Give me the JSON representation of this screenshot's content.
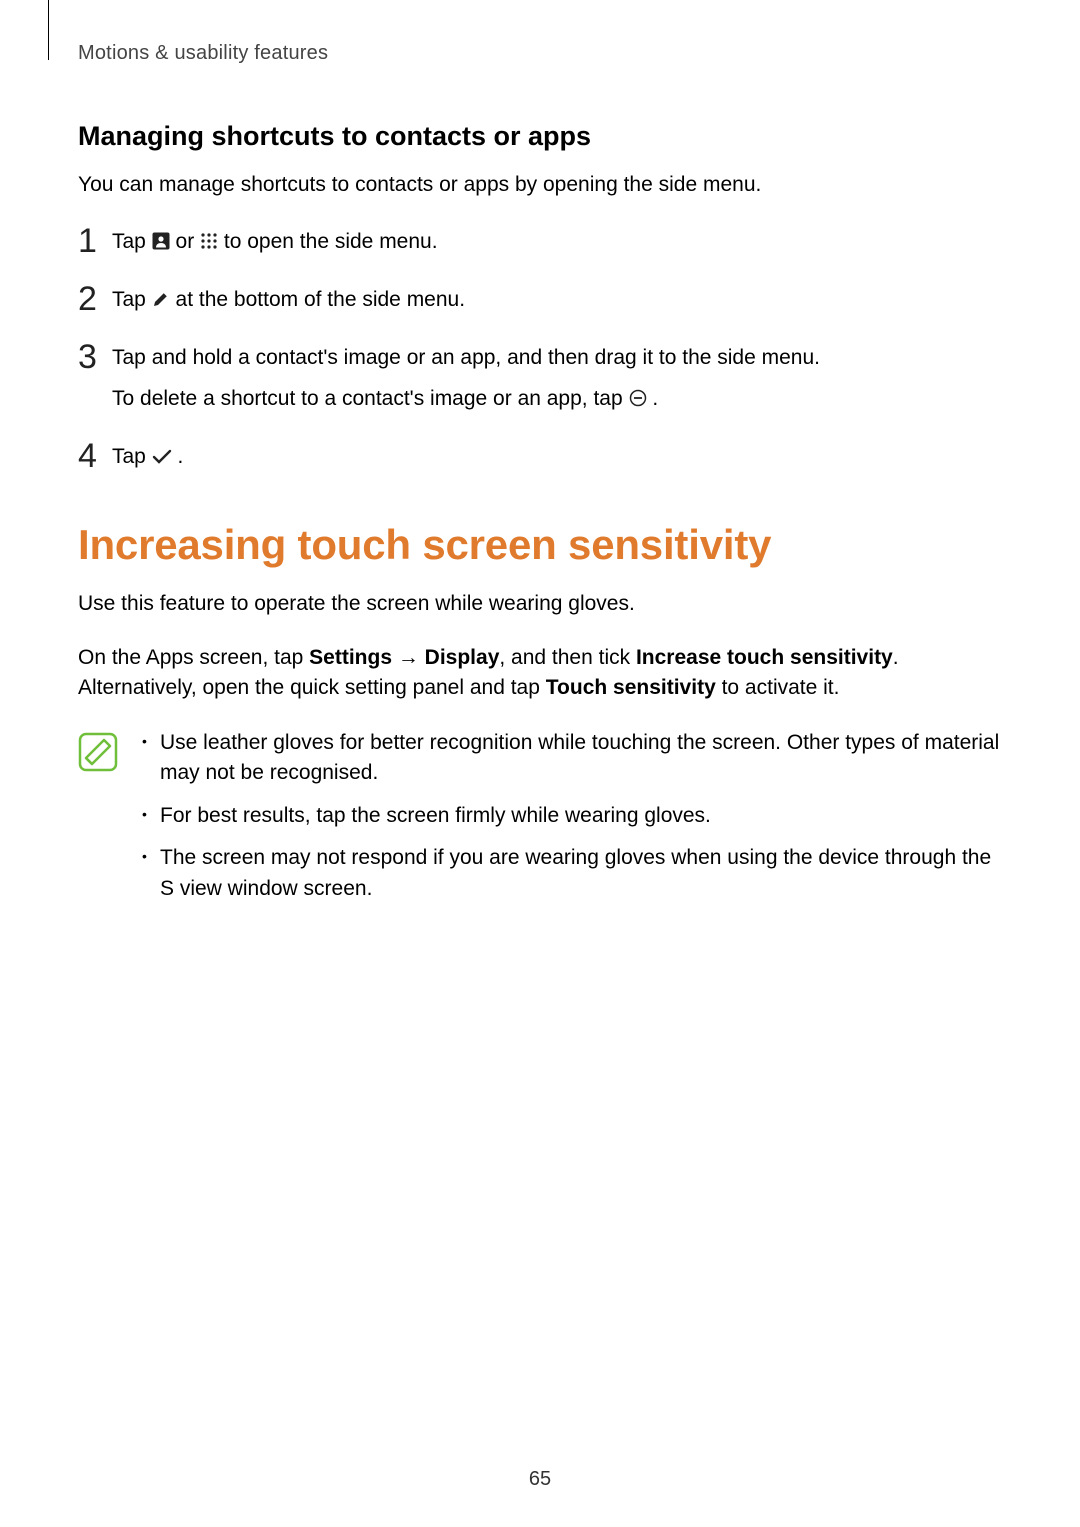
{
  "header": {
    "running_head": "Motions & usability features"
  },
  "subsection": {
    "title": "Managing shortcuts to contacts or apps",
    "intro": "You can manage shortcuts to contacts or apps by opening the side menu."
  },
  "steps": [
    {
      "num": "1",
      "pre": "Tap ",
      "mid_or": " or ",
      "post": " to open the side menu."
    },
    {
      "num": "2",
      "pre": "Tap ",
      "post": " at the bottom of the side menu."
    },
    {
      "num": "3",
      "line1": "Tap and hold a contact's image or an app, and then drag it to the side menu.",
      "line2_pre": "To delete a shortcut to a contact's image or an app, tap ",
      "line2_post": "."
    },
    {
      "num": "4",
      "pre": "Tap ",
      "post": "."
    }
  ],
  "section": {
    "title": "Increasing touch screen sensitivity",
    "p1": "Use this feature to operate the screen while wearing gloves.",
    "p2": {
      "t1": "On the Apps screen, tap ",
      "b1": "Settings",
      "arrow": " → ",
      "b2": "Display",
      "t2": ", and then tick ",
      "b3": "Increase touch sensitivity",
      "t3": ". Alternatively, open the quick setting panel and tap ",
      "b4": "Touch sensitivity",
      "t4": " to activate it."
    }
  },
  "notes": [
    "Use leather gloves for better recognition while touching the screen. Other types of material may not be recognised.",
    "For best results, tap the screen firmly while wearing gloves.",
    "The screen may not respond if you are wearing gloves when using the device through the S view window screen."
  ],
  "page_number": "65"
}
